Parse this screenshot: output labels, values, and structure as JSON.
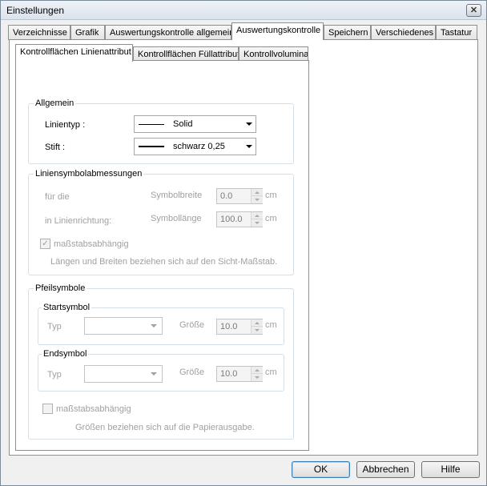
{
  "window": {
    "title": "Einstellungen",
    "close_glyph": "✕"
  },
  "tabs": [
    {
      "label": "Verzeichnisse"
    },
    {
      "label": "Grafik"
    },
    {
      "label": "Auswertungskontrolle allgemein"
    },
    {
      "label": "Auswertungskontrolle"
    },
    {
      "label": "Speichern"
    },
    {
      "label": "Verschiedenes"
    },
    {
      "label": "Tastatur"
    }
  ],
  "subtabs": [
    {
      "label": "Kontrollflächen Linienattribut"
    },
    {
      "label": "Kontrollflächen Füllattribut"
    },
    {
      "label": "Kontrollvolumina"
    }
  ],
  "allgemein": {
    "title": "Allgemein",
    "linientyp_label": "Linientyp :",
    "linientyp_value": "Solid",
    "stift_label": "Stift :",
    "stift_value": "schwarz 0,25"
  },
  "liniensymbol": {
    "title": "Liniensymbolabmessungen",
    "fuer_die": "für die",
    "in_linienrichtung": "in Linienrichtung:",
    "symbolbreite_label": "Symbolbreite",
    "symbolbreite_value": "0.0",
    "symbollaenge_label": "Symbollänge",
    "symbollaenge_value": "100.0",
    "unit": "cm",
    "checkbox_label": "maßstabsabhängig",
    "checkbox_glyph": "✓",
    "hint": "Längen und Breiten beziehen sich auf den Sicht-Maßstab."
  },
  "pfeilsymbole": {
    "title": "Pfeilsymbole",
    "start": {
      "title": "Startsymbol",
      "typ_label": "Typ",
      "groesse_label": "Größe",
      "groesse_value": "10.0",
      "unit": "cm"
    },
    "end": {
      "title": "Endsymbol",
      "typ_label": "Typ",
      "groesse_label": "Größe",
      "groesse_value": "10.0",
      "unit": "cm"
    },
    "checkbox_label": "maßstabsabhängig",
    "hint": "Größen beziehen sich auf die Papierausgabe."
  },
  "buttons": {
    "ok": "OK",
    "cancel": "Abbrechen",
    "help": "Hilfe"
  }
}
